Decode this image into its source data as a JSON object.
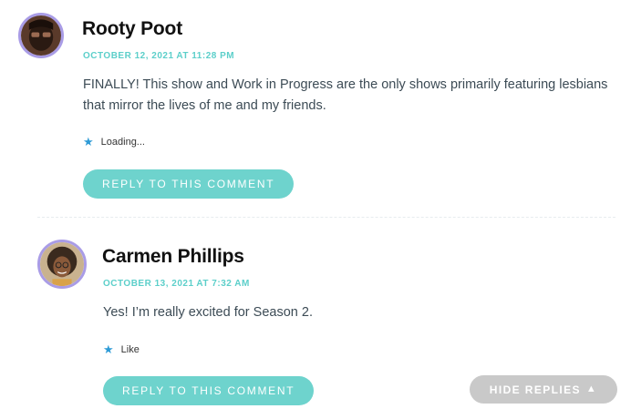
{
  "comments": [
    {
      "author": "Rooty Poot",
      "date": "OCTOBER 12, 2021 AT 11:28 PM",
      "text": "FINALLY! This show and Work in Progress are the only shows primarily featuring lesbians that mirror the lives of me and my friends.",
      "like_label": "Loading...",
      "reply_label": "REPLY TO THIS COMMENT"
    },
    {
      "author": "Carmen Phillips",
      "date": "OCTOBER 13, 2021 AT 7:32 AM",
      "text": "Yes! I’m really excited for Season 2.",
      "like_label": "Like",
      "reply_label": "REPLY TO THIS COMMENT"
    }
  ],
  "hide_replies": {
    "label": "HIDE REPLIES",
    "icon": "triangle-up-icon"
  },
  "colors": {
    "accent": "#6ed3cd",
    "meta": "#5ccfca",
    "avatar_border": "#a99ce6",
    "star": "#2e9bd6",
    "hide_button": "#c9c9c9"
  }
}
